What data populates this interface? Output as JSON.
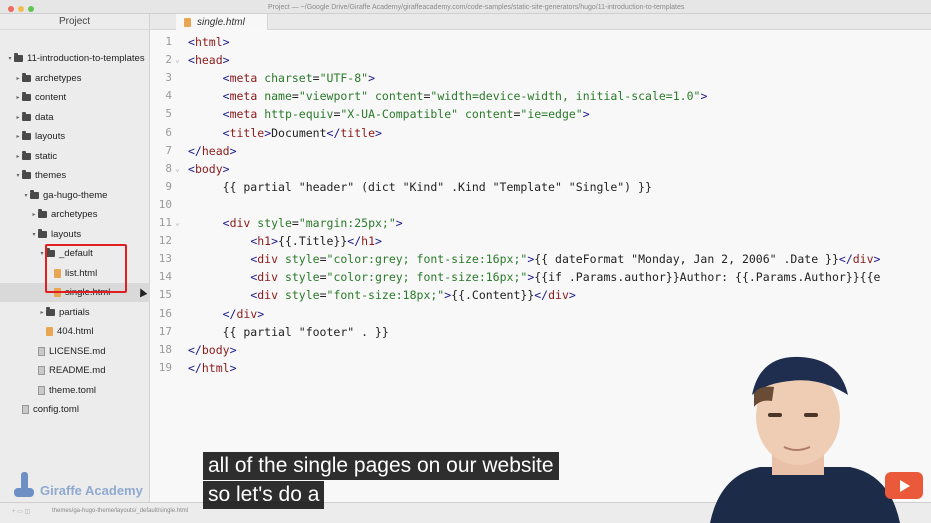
{
  "window": {
    "title": "Project — ~/Google Drive/Giraffe Academy/giraffeacademy.com/code-samples/static-site-generators/hugo/11-introduction-to-templates"
  },
  "sidebar": {
    "header": "Project",
    "items": [
      {
        "label": "11-introduction-to-templates",
        "type": "folder",
        "depth": 0,
        "open": true
      },
      {
        "label": "archetypes",
        "type": "folder",
        "depth": 1,
        "open": false
      },
      {
        "label": "content",
        "type": "folder",
        "depth": 1,
        "open": false
      },
      {
        "label": "data",
        "type": "folder",
        "depth": 1,
        "open": false
      },
      {
        "label": "layouts",
        "type": "folder",
        "depth": 1,
        "open": false
      },
      {
        "label": "static",
        "type": "folder",
        "depth": 1,
        "open": false
      },
      {
        "label": "themes",
        "type": "folder",
        "depth": 1,
        "open": true
      },
      {
        "label": "ga-hugo-theme",
        "type": "folder",
        "depth": 2,
        "open": true
      },
      {
        "label": "archetypes",
        "type": "folder",
        "depth": 3,
        "open": false
      },
      {
        "label": "layouts",
        "type": "folder",
        "depth": 3,
        "open": true
      },
      {
        "label": "_default",
        "type": "folder",
        "depth": 4,
        "open": true
      },
      {
        "label": "list.html",
        "type": "html",
        "depth": 5
      },
      {
        "label": "single.html",
        "type": "html",
        "depth": 5,
        "selected": true
      },
      {
        "label": "partials",
        "type": "folder",
        "depth": 4,
        "open": false
      },
      {
        "label": "404.html",
        "type": "html",
        "depth": 4
      },
      {
        "label": "LICENSE.md",
        "type": "file",
        "depth": 3
      },
      {
        "label": "README.md",
        "type": "file",
        "depth": 3
      },
      {
        "label": "theme.toml",
        "type": "file",
        "depth": 3
      },
      {
        "label": "config.toml",
        "type": "file",
        "depth": 1
      }
    ],
    "logo_text": "Giraffe Academy"
  },
  "tab": {
    "label": "single.html"
  },
  "editor": {
    "lines": [
      {
        "n": "1",
        "fold": "",
        "tokens": [
          [
            "tag",
            "<"
          ],
          [
            "tagname",
            "html"
          ],
          [
            "tag",
            ">"
          ]
        ]
      },
      {
        "n": "2",
        "fold": "⌄",
        "tokens": [
          [
            "tag",
            "<"
          ],
          [
            "tagname",
            "head"
          ],
          [
            "tag",
            ">"
          ]
        ]
      },
      {
        "n": "3",
        "fold": "",
        "tokens": [
          [
            "plain",
            "     "
          ],
          [
            "tag",
            "<"
          ],
          [
            "tagname",
            "meta "
          ],
          [
            "attr",
            "charset"
          ],
          [
            "plain",
            "="
          ],
          [
            "str",
            "\"UTF-8\""
          ],
          [
            "tag",
            ">"
          ]
        ]
      },
      {
        "n": "4",
        "fold": "",
        "tokens": [
          [
            "plain",
            "     "
          ],
          [
            "tag",
            "<"
          ],
          [
            "tagname",
            "meta "
          ],
          [
            "attr",
            "name"
          ],
          [
            "plain",
            "="
          ],
          [
            "str",
            "\"viewport\" "
          ],
          [
            "attr",
            "content"
          ],
          [
            "plain",
            "="
          ],
          [
            "str",
            "\"width=device-width, initial-scale=1.0\""
          ],
          [
            "tag",
            ">"
          ]
        ]
      },
      {
        "n": "5",
        "fold": "",
        "tokens": [
          [
            "plain",
            "     "
          ],
          [
            "tag",
            "<"
          ],
          [
            "tagname",
            "meta "
          ],
          [
            "attr",
            "http-equiv"
          ],
          [
            "plain",
            "="
          ],
          [
            "str",
            "\"X-UA-Compatible\" "
          ],
          [
            "attr",
            "content"
          ],
          [
            "plain",
            "="
          ],
          [
            "str",
            "\"ie=edge\""
          ],
          [
            "tag",
            ">"
          ]
        ]
      },
      {
        "n": "6",
        "fold": "",
        "tokens": [
          [
            "plain",
            "     "
          ],
          [
            "tag",
            "<"
          ],
          [
            "tagname",
            "title"
          ],
          [
            "tag",
            ">"
          ],
          [
            "plain",
            "Document"
          ],
          [
            "tag",
            "</"
          ],
          [
            "tagname",
            "title"
          ],
          [
            "tag",
            ">"
          ]
        ]
      },
      {
        "n": "7",
        "fold": "",
        "tokens": [
          [
            "tag",
            "</"
          ],
          [
            "tagname",
            "head"
          ],
          [
            "tag",
            ">"
          ]
        ]
      },
      {
        "n": "8",
        "fold": "⌄",
        "tokens": [
          [
            "tag",
            "<"
          ],
          [
            "tagname",
            "body"
          ],
          [
            "tag",
            ">"
          ]
        ]
      },
      {
        "n": "9",
        "fold": "",
        "tokens": [
          [
            "plain",
            "     {{ partial \"header\" (dict \"Kind\" .Kind \"Template\" \"Single\") }}"
          ]
        ]
      },
      {
        "n": "10",
        "fold": "",
        "tokens": [
          [
            "plain",
            ""
          ]
        ]
      },
      {
        "n": "11",
        "fold": "⌄",
        "tokens": [
          [
            "plain",
            "     "
          ],
          [
            "tag",
            "<"
          ],
          [
            "tagname",
            "div "
          ],
          [
            "attr",
            "style"
          ],
          [
            "plain",
            "="
          ],
          [
            "str",
            "\"margin:25px;\""
          ],
          [
            "tag",
            ">"
          ]
        ]
      },
      {
        "n": "12",
        "fold": "",
        "tokens": [
          [
            "plain",
            "         "
          ],
          [
            "tag",
            "<"
          ],
          [
            "tagname",
            "h1"
          ],
          [
            "tag",
            ">"
          ],
          [
            "plain",
            "{{.Title}}"
          ],
          [
            "tag",
            "</"
          ],
          [
            "tagname",
            "h1"
          ],
          [
            "tag",
            ">"
          ]
        ]
      },
      {
        "n": "13",
        "fold": "",
        "tokens": [
          [
            "plain",
            "         "
          ],
          [
            "tag",
            "<"
          ],
          [
            "tagname",
            "div "
          ],
          [
            "attr",
            "style"
          ],
          [
            "plain",
            "="
          ],
          [
            "str",
            "\"color:grey; font-size:16px;\""
          ],
          [
            "tag",
            ">"
          ],
          [
            "plain",
            "{{ dateFormat \"Monday, Jan 2, 2006\" .Date }}"
          ],
          [
            "tag",
            "</"
          ],
          [
            "tagname",
            "div"
          ],
          [
            "tag",
            ">"
          ]
        ]
      },
      {
        "n": "14",
        "fold": "",
        "tokens": [
          [
            "plain",
            "         "
          ],
          [
            "tag",
            "<"
          ],
          [
            "tagname",
            "div "
          ],
          [
            "attr",
            "style"
          ],
          [
            "plain",
            "="
          ],
          [
            "str",
            "\"color:grey; font-size:16px;\""
          ],
          [
            "tag",
            ">"
          ],
          [
            "plain",
            "{{if .Params.author}}Author: {{.Params.Author}}{{e"
          ]
        ]
      },
      {
        "n": "15",
        "fold": "",
        "tokens": [
          [
            "plain",
            "         "
          ],
          [
            "tag",
            "<"
          ],
          [
            "tagname",
            "div "
          ],
          [
            "attr",
            "style"
          ],
          [
            "plain",
            "="
          ],
          [
            "str",
            "\"font-size:18px;\""
          ],
          [
            "tag",
            ">"
          ],
          [
            "plain",
            "{{.Content}}"
          ],
          [
            "tag",
            "</"
          ],
          [
            "tagname",
            "div"
          ],
          [
            "tag",
            ">"
          ]
        ]
      },
      {
        "n": "16",
        "fold": "",
        "tokens": [
          [
            "plain",
            "     "
          ],
          [
            "tag",
            "</"
          ],
          [
            "tagname",
            "div"
          ],
          [
            "tag",
            ">"
          ]
        ]
      },
      {
        "n": "17",
        "fold": "",
        "tokens": [
          [
            "plain",
            "     {{ partial \"footer\" . }}"
          ]
        ]
      },
      {
        "n": "18",
        "fold": "",
        "tokens": [
          [
            "tag",
            "</"
          ],
          [
            "tagname",
            "body"
          ],
          [
            "tag",
            ">"
          ]
        ]
      },
      {
        "n": "19",
        "fold": "",
        "tokens": [
          [
            "tag",
            "</"
          ],
          [
            "tagname",
            "html"
          ],
          [
            "tag",
            ">"
          ]
        ]
      }
    ]
  },
  "subtitles": {
    "line1": "all of the single pages on our website",
    "line2": "so let's do a"
  },
  "statusbar": {
    "path": "themes/ga-hugo-theme/layouts/_default/single.html"
  },
  "colors": {
    "highlight_box": "#e02020",
    "html_file_icon": "#e8a552",
    "youtube": "#ea5a3a"
  }
}
